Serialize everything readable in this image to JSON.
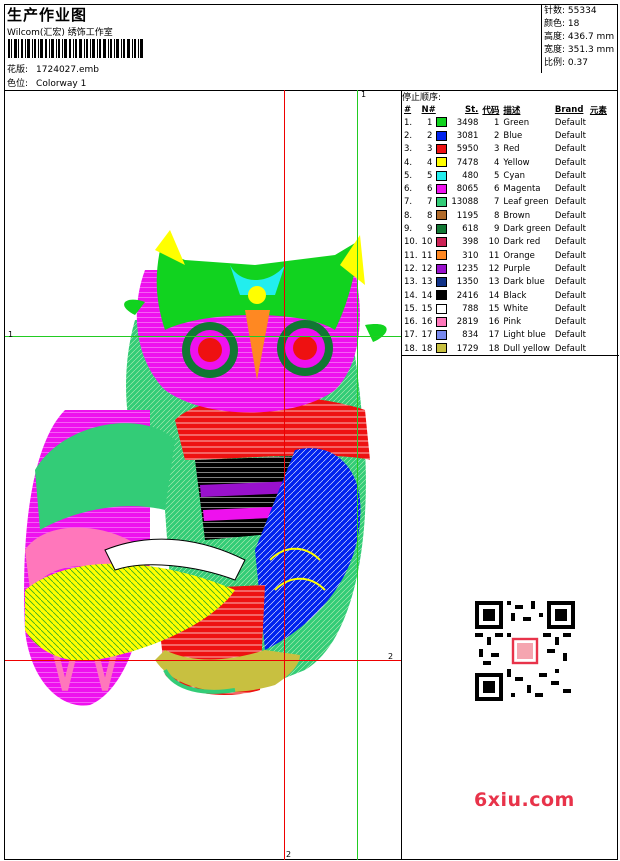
{
  "header": {
    "title": "生产作业图",
    "subtitle": "Wilcom(汇宏) 绣饰工作室",
    "file_label": "花版:",
    "file_name": "1724027.emb",
    "colorway_label": "色位:",
    "colorway_name": "Colorway 1"
  },
  "stats": [
    {
      "label": "针数:",
      "value": "55334"
    },
    {
      "label": "颜色:",
      "value": "18"
    },
    {
      "label": "高度:",
      "value": "436.7 mm"
    },
    {
      "label": "宽度:",
      "value": "351.3 mm"
    },
    {
      "label": "比例:",
      "value": "0.37"
    }
  ],
  "sequence": {
    "label": "停止顺序:",
    "headers": [
      "#",
      "N#",
      "St.",
      "代码",
      "描述",
      "Brand",
      "元素"
    ],
    "rows": [
      {
        "idx": "1.",
        "n": "1",
        "st": "3498",
        "code": "1",
        "desc": "Green",
        "brand": "Default",
        "color": "#11d31f"
      },
      {
        "idx": "2.",
        "n": "2",
        "st": "3081",
        "code": "2",
        "desc": "Blue",
        "brand": "Default",
        "color": "#0022ee"
      },
      {
        "idx": "3.",
        "n": "3",
        "st": "5950",
        "code": "3",
        "desc": "Red",
        "brand": "Default",
        "color": "#ee1111"
      },
      {
        "idx": "4.",
        "n": "4",
        "st": "7478",
        "code": "4",
        "desc": "Yellow",
        "brand": "Default",
        "color": "#ffff00"
      },
      {
        "idx": "5.",
        "n": "5",
        "st": "480",
        "code": "5",
        "desc": "Cyan",
        "brand": "Default",
        "color": "#22eeee"
      },
      {
        "idx": "6.",
        "n": "6",
        "st": "8065",
        "code": "6",
        "desc": "Magenta",
        "brand": "Default",
        "color": "#ee11ee"
      },
      {
        "idx": "7.",
        "n": "7",
        "st": "13088",
        "code": "7",
        "desc": "Leaf green",
        "brand": "Default",
        "color": "#33cc77"
      },
      {
        "idx": "8.",
        "n": "8",
        "st": "1195",
        "code": "8",
        "desc": "Brown",
        "brand": "Default",
        "color": "#b06a2a"
      },
      {
        "idx": "9.",
        "n": "9",
        "st": "618",
        "code": "9",
        "desc": "Dark green",
        "brand": "Default",
        "color": "#117733"
      },
      {
        "idx": "10.",
        "n": "10",
        "st": "398",
        "code": "10",
        "desc": "Dark red",
        "brand": "Default",
        "color": "#cc2255"
      },
      {
        "idx": "11.",
        "n": "11",
        "st": "310",
        "code": "11",
        "desc": "Orange",
        "brand": "Default",
        "color": "#ff8822"
      },
      {
        "idx": "12.",
        "n": "12",
        "st": "1235",
        "code": "12",
        "desc": "Purple",
        "brand": "Default",
        "color": "#9911cc"
      },
      {
        "idx": "13.",
        "n": "13",
        "st": "1350",
        "code": "13",
        "desc": "Dark blue",
        "brand": "Default",
        "color": "#113388"
      },
      {
        "idx": "14.",
        "n": "14",
        "st": "2416",
        "code": "14",
        "desc": "Black",
        "brand": "Default",
        "color": "#000000"
      },
      {
        "idx": "15.",
        "n": "15",
        "st": "788",
        "code": "15",
        "desc": "White",
        "brand": "Default",
        "color": "#ffffff"
      },
      {
        "idx": "16.",
        "n": "16",
        "st": "2819",
        "code": "16",
        "desc": "Pink",
        "brand": "Default",
        "color": "#ff77bb"
      },
      {
        "idx": "17.",
        "n": "17",
        "st": "834",
        "code": "17",
        "desc": "Light blue",
        "brand": "Default",
        "color": "#7788ee"
      },
      {
        "idx": "18.",
        "n": "18",
        "st": "1729",
        "code": "18",
        "desc": "Dull yellow",
        "brand": "Default",
        "color": "#c8c040"
      }
    ]
  },
  "guides": {
    "label_1": "1",
    "label_2": "2",
    "green": "#22cc22",
    "red": "#ee0000"
  },
  "watermark": {
    "text": "6xiu.com",
    "color": "#e8334a"
  }
}
